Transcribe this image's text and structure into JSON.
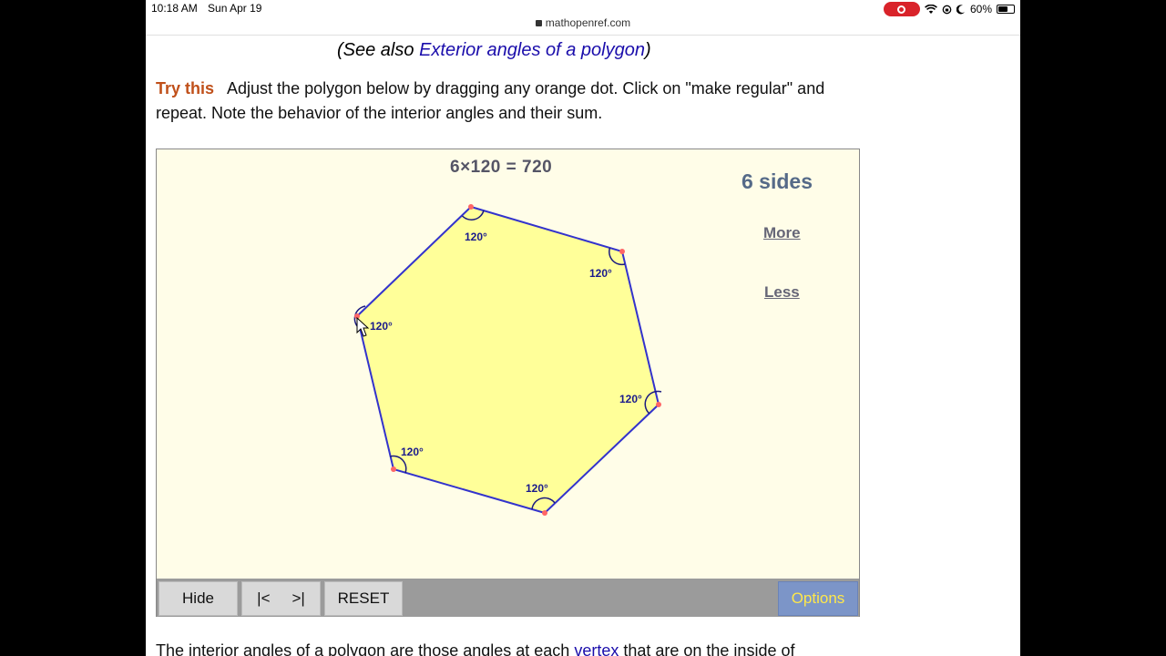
{
  "status": {
    "time": "10:18 AM",
    "date": "Sun Apr 19",
    "battery": "60%"
  },
  "url": "mathopenref.com",
  "see_also": {
    "prefix": "(See also ",
    "link": "Exterior angles of a polygon",
    "suffix": ")"
  },
  "try_this": {
    "label": "Try this",
    "text": "Adjust the polygon below by dragging any orange dot. Click on \"make regular\" and repeat. Note the behavior of the interior angles and their sum."
  },
  "applet": {
    "formula": "6×120 = 720",
    "sides_text": "6 sides",
    "more_label": "More",
    "less_label": "Less",
    "angle_labels": [
      "120°",
      "120°",
      "120°",
      "120°",
      "120°",
      "120°"
    ],
    "colors": {
      "fill": "#ffff99",
      "edge": "#3333cc",
      "vertex": "#ff6666",
      "background": "#fffde8"
    }
  },
  "toolbar": {
    "hide_label": "Hide",
    "first_label": "|<",
    "last_label": ">|",
    "reset_label": "RESET",
    "options_label": "Options"
  },
  "bottom": {
    "prefix": "The interior angles of a polygon are those angles at each ",
    "link": "vertex",
    "suffix": " that are on the inside of"
  }
}
